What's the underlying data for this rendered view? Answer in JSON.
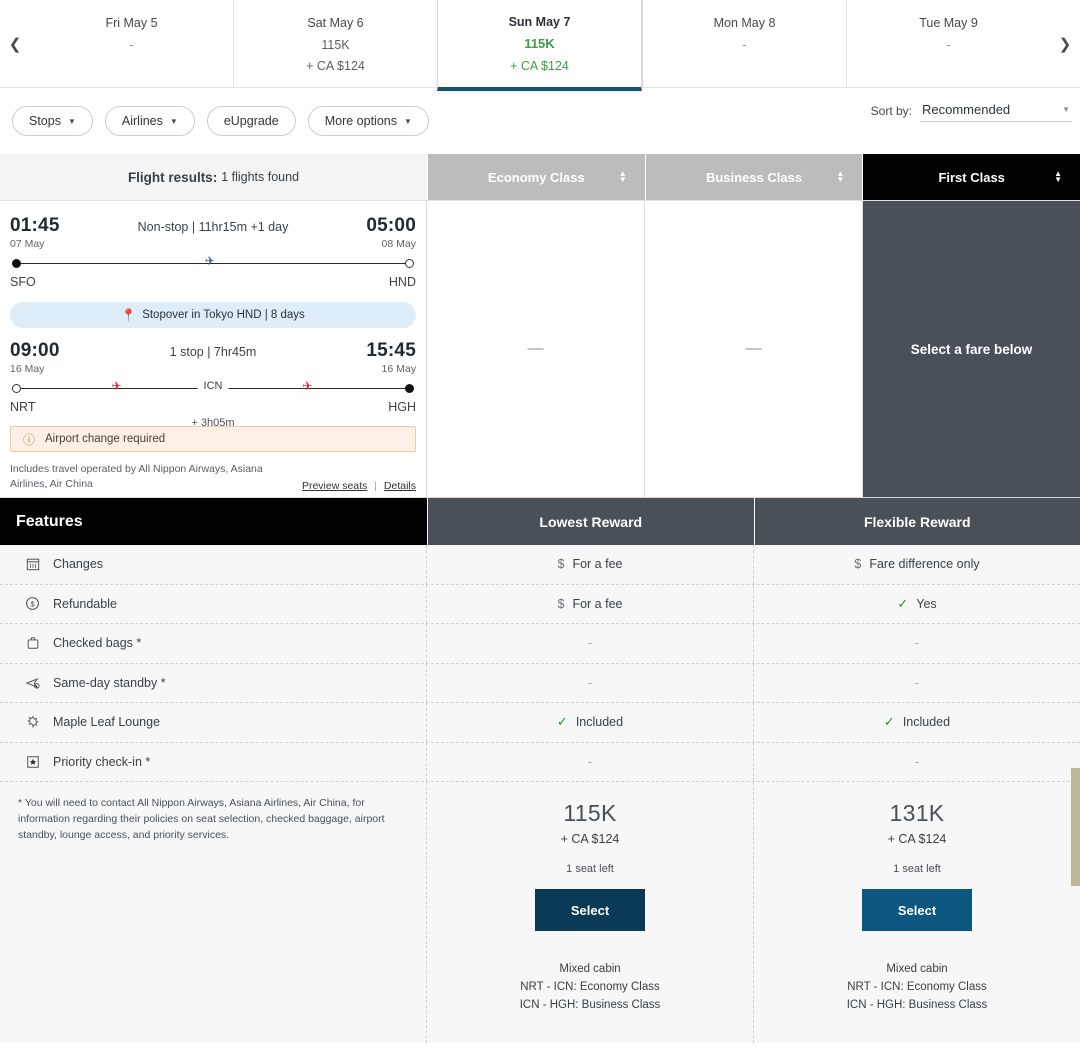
{
  "datebar": {
    "prev_icon": "chevron-left-icon",
    "next_icon": "chevron-right-icon",
    "dates": [
      {
        "day": "Fri May 5",
        "points": "-",
        "cash": "",
        "selected": false
      },
      {
        "day": "Sat May 6",
        "points": "115K",
        "cash": "+ CA $124",
        "selected": false
      },
      {
        "day": "Sun May 7",
        "points": "115K",
        "cash": "+ CA $124",
        "selected": true
      },
      {
        "day": "Mon May 8",
        "points": "-",
        "cash": "",
        "selected": false
      },
      {
        "day": "Tue May 9",
        "points": "-",
        "cash": "",
        "selected": false
      }
    ]
  },
  "filters": {
    "pills": [
      {
        "label": "Stops",
        "has_caret": true
      },
      {
        "label": "Airlines",
        "has_caret": true
      },
      {
        "label": "eUpgrade",
        "has_caret": false
      },
      {
        "label": "More options",
        "has_caret": true
      }
    ],
    "sort_label": "Sort by:",
    "sort_value": "Recommended"
  },
  "classbar": {
    "results_prefix": "Flight results:",
    "results_count": "1 flights found",
    "columns": [
      {
        "label": "Economy Class",
        "active": false
      },
      {
        "label": "Business Class",
        "active": false
      },
      {
        "label": "First Class",
        "active": true
      }
    ]
  },
  "flight": {
    "leg1": {
      "depart_time": "01:45",
      "depart_date": "07 May",
      "summary": "Non-stop | 11hr15m +1 day",
      "arrive_time": "05:00",
      "arrive_date": "08 May",
      "origin": "SFO",
      "destination": "HND"
    },
    "stopover": "Stopover in Tokyo HND | 8 days",
    "leg2": {
      "depart_time": "09:00",
      "depart_date": "16 May",
      "summary": "1 stop | 7hr45m",
      "arrive_time": "15:45",
      "arrive_date": "16 May",
      "origin": "NRT",
      "destination": "HGH",
      "connection_code": "ICN",
      "connection_duration": "+ 3h05m"
    },
    "warning": "Airport change required",
    "operated_by": "Includes travel operated by All Nippon Airways, Asiana Airlines, Air China",
    "preview_seats": "Preview seats",
    "details": "Details",
    "economy_value": "—",
    "business_value": "—",
    "first_value": "Select a fare below"
  },
  "features": {
    "title": "Features",
    "columns": [
      "Lowest Reward",
      "Flexible Reward"
    ],
    "rows": [
      {
        "icon": "calendar-icon",
        "label": "Changes",
        "values": [
          {
            "mark": "$",
            "mark_type": "dollar",
            "text": "For a fee"
          },
          {
            "mark": "$",
            "mark_type": "dollar",
            "text": "Fare difference only"
          }
        ]
      },
      {
        "icon": "dollar-circle-icon",
        "label": "Refundable",
        "values": [
          {
            "mark": "$",
            "mark_type": "dollar",
            "text": "For a fee"
          },
          {
            "mark": "✓",
            "mark_type": "check",
            "text": "Yes"
          }
        ]
      },
      {
        "icon": "suitcase-icon",
        "label": "Checked bags *",
        "values": [
          {
            "mark": "",
            "mark_type": "none",
            "text": "-"
          },
          {
            "mark": "",
            "mark_type": "none",
            "text": "-"
          }
        ]
      },
      {
        "icon": "standby-plane-icon",
        "label": "Same-day standby *",
        "values": [
          {
            "mark": "",
            "mark_type": "none",
            "text": "-"
          },
          {
            "mark": "",
            "mark_type": "none",
            "text": "-"
          }
        ]
      },
      {
        "icon": "lounge-icon",
        "label": "Maple Leaf Lounge",
        "values": [
          {
            "mark": "✓",
            "mark_type": "check",
            "text": "Included"
          },
          {
            "mark": "✓",
            "mark_type": "check",
            "text": "Included"
          }
        ]
      },
      {
        "icon": "priority-star-icon",
        "label": "Priority check-in *",
        "values": [
          {
            "mark": "",
            "mark_type": "none",
            "text": "-"
          },
          {
            "mark": "",
            "mark_type": "none",
            "text": "-"
          }
        ]
      }
    ]
  },
  "pricing": {
    "footnote": "* You will need to contact All Nippon Airways, Asiana Airlines, Air China, for information regarding their policies on seat selection, checked baggage, airport standby, lounge access, and priority services.",
    "fares": [
      {
        "points": "115K",
        "cash": "+ CA $124",
        "seats": "1 seat left",
        "select_label": "Select",
        "select_color": "#0b3a58",
        "mixed_title": "Mixed cabin",
        "mixed_lines": [
          "NRT - ICN: Economy Class",
          "ICN - HGH: Business Class"
        ]
      },
      {
        "points": "131K",
        "cash": "+ CA $124",
        "seats": "1 seat left",
        "select_label": "Select",
        "select_color": "#0d5680",
        "mixed_title": "Mixed cabin",
        "mixed_lines": [
          "NRT - ICN: Economy Class",
          "ICN - HGH: Business Class"
        ]
      }
    ]
  },
  "colors": {
    "accent_green": "#3f9b46",
    "selected_tab_underline": "#16506f",
    "active_class_bg": "#000000",
    "inactive_class_bg": "#bcbcbc",
    "panel_dark": "#4a5058",
    "warn_border": "#f0c9a8",
    "stopover_bg": "#deedf7",
    "scrollbar_thumb": "#bdb79a"
  }
}
